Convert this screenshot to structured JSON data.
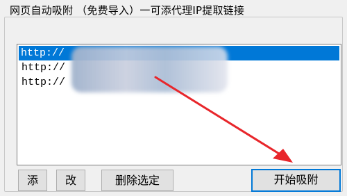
{
  "group": {
    "title": "网页自动吸附 （免费导入）一可添代理IP提取链接"
  },
  "list": {
    "items": [
      {
        "text": "http://",
        "selected": true
      },
      {
        "text": "http://",
        "selected": false
      },
      {
        "text": "http://",
        "selected": false
      }
    ]
  },
  "buttons": {
    "add_label": "添",
    "edit_label": "改",
    "delete_label": "删除选定",
    "start_label": "开始吸附"
  },
  "colors": {
    "selection": "#0078d7",
    "arrow": "#e8262b",
    "window_bg": "#f0f0f0"
  },
  "icons": {
    "annotation": "red-arrow"
  }
}
